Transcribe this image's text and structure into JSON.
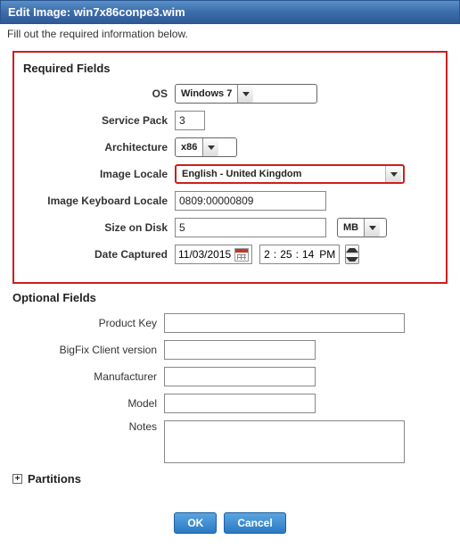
{
  "title": "Edit Image: win7x86conpe3.wim",
  "subtitle": "Fill out the required information below.",
  "required": {
    "heading": "Required Fields",
    "os": {
      "label": "OS",
      "value": "Windows 7"
    },
    "service_pack": {
      "label": "Service Pack",
      "value": "3"
    },
    "architecture": {
      "label": "Architecture",
      "value": "x86"
    },
    "image_locale": {
      "label": "Image Locale",
      "value": "English - United Kingdom"
    },
    "keyboard_locale": {
      "label": "Image Keyboard Locale",
      "value": "0809:00000809"
    },
    "size_on_disk": {
      "label": "Size on Disk",
      "value": "5",
      "unit": "MB"
    },
    "date_captured": {
      "label": "Date Captured",
      "date": "11/03/2015",
      "hour": "2",
      "minute": "25",
      "second": "14",
      "ampm": "PM"
    }
  },
  "optional": {
    "heading": "Optional Fields",
    "product_key": {
      "label": "Product Key",
      "value": ""
    },
    "client_version": {
      "label": "BigFix Client version",
      "value": ""
    },
    "manufacturer": {
      "label": "Manufacturer",
      "value": ""
    },
    "model": {
      "label": "Model",
      "value": ""
    },
    "notes": {
      "label": "Notes",
      "value": ""
    }
  },
  "partitions": {
    "label": "Partitions",
    "expander": "+"
  },
  "buttons": {
    "ok": "OK",
    "cancel": "Cancel"
  }
}
